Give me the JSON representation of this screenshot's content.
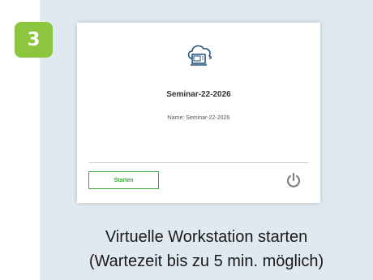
{
  "step": {
    "number": "3"
  },
  "card": {
    "title": "Seminar-22-2026",
    "name_line": "Name: Seminar-22-2026",
    "start_label": "Starten"
  },
  "caption": {
    "line1": "Virtuelle Workstation starten",
    "line2": "(Wartezeit bis zu 5 min. möglich)"
  },
  "icons": {
    "workstation": "cloud-computer-icon",
    "power": "power-icon"
  },
  "colors": {
    "panel_bg": "#dfe9ef",
    "badge_green": "#8cc63f",
    "button_green": "#3aa53a",
    "icon_blue": "#1f4e79"
  }
}
